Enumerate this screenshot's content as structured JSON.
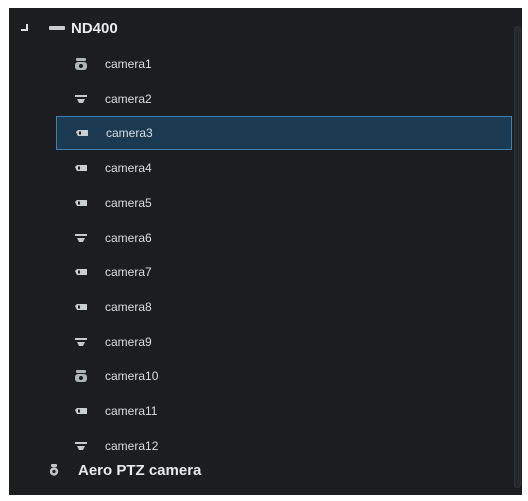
{
  "tree": {
    "recorder": {
      "label": "ND400",
      "icon": "recorder-device-icon",
      "expanded": true,
      "cameras": [
        {
          "label": "camera1",
          "icon": "ptz-camera-icon",
          "selected": false
        },
        {
          "label": "camera2",
          "icon": "dome-camera-icon",
          "selected": false
        },
        {
          "label": "camera3",
          "icon": "box-camera-icon",
          "selected": true
        },
        {
          "label": "camera4",
          "icon": "box-camera-icon",
          "selected": false
        },
        {
          "label": "camera5",
          "icon": "box-camera-icon",
          "selected": false
        },
        {
          "label": "camera6",
          "icon": "dome-camera-icon",
          "selected": false
        },
        {
          "label": "camera7",
          "icon": "box-camera-icon",
          "selected": false
        },
        {
          "label": "camera8",
          "icon": "box-camera-icon",
          "selected": false
        },
        {
          "label": "camera9",
          "icon": "dome-camera-icon",
          "selected": false
        },
        {
          "label": "camera10",
          "icon": "ptz-camera-icon",
          "selected": false
        },
        {
          "label": "camera11",
          "icon": "box-camera-icon",
          "selected": false
        },
        {
          "label": "camera12",
          "icon": "dome-camera-icon",
          "selected": false
        }
      ]
    },
    "standalone": {
      "label": "Aero PTZ camera",
      "icon": "ptz-camera-icon"
    }
  },
  "colors": {
    "background": "#1b1d20",
    "selection_fill": "#1b3a52",
    "selection_border": "#3c7fb0",
    "text": "#e8ebee"
  }
}
